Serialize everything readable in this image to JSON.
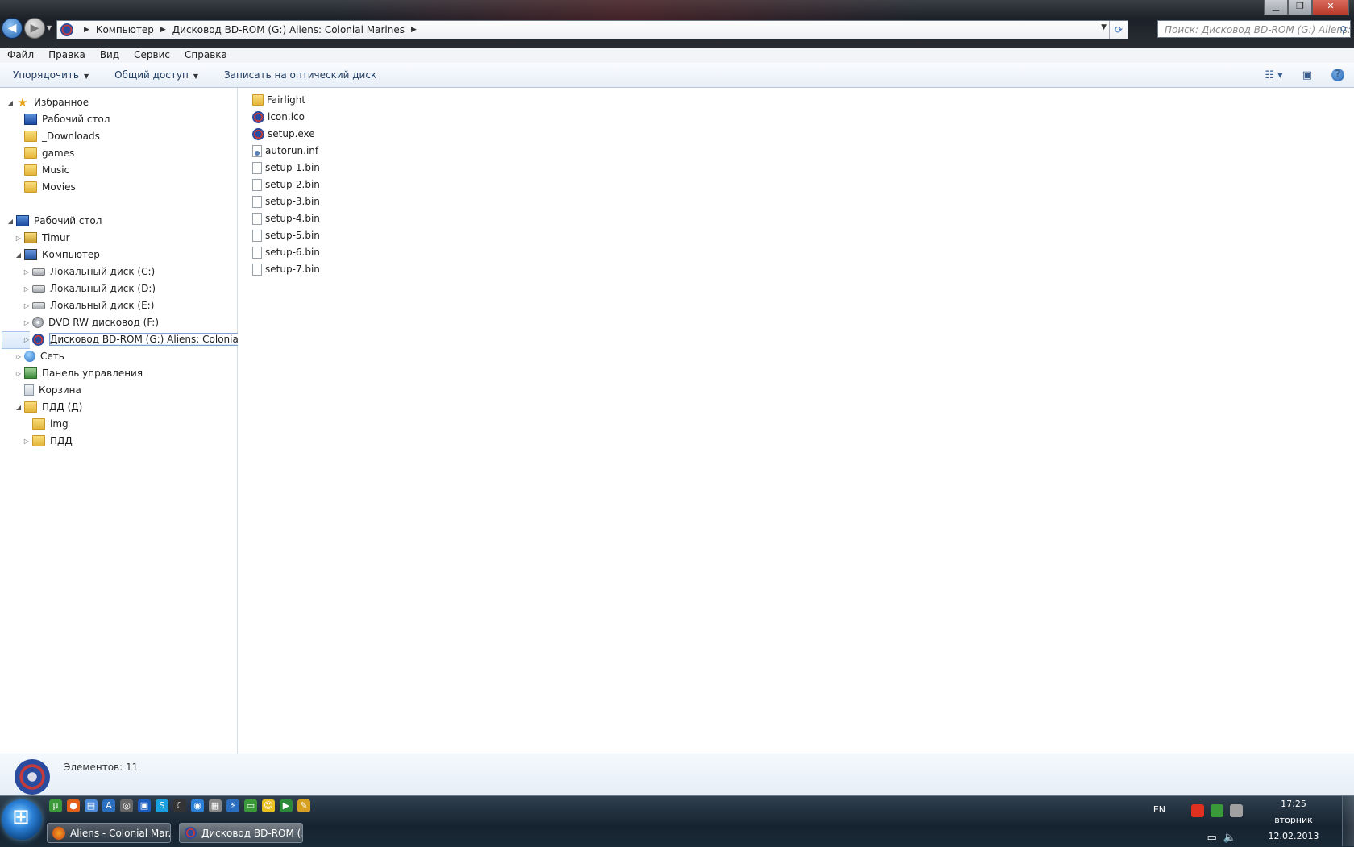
{
  "window": {
    "title_buttons": {
      "minimize": "▁",
      "maximize": "❐",
      "close": "✕"
    }
  },
  "address": {
    "crumbs": [
      "Компьютер",
      "Дисковод BD-ROM (G:) Aliens: Colonial Marines"
    ],
    "search_placeholder": "Поиск: Дисковод BD-ROM (G:) Aliens:...",
    "back_icon": "back-arrow-icon",
    "forward_icon": "forward-arrow-icon"
  },
  "menu": [
    "Файл",
    "Правка",
    "Вид",
    "Сервис",
    "Справка"
  ],
  "toolbar": {
    "organize": "Упорядочить",
    "share": "Общий доступ",
    "burn": "Записать на оптический диск"
  },
  "nav": {
    "favorites": {
      "label": "Избранное",
      "items": [
        "Рабочий стол",
        "_Downloads",
        "games",
        "Music",
        "Movies"
      ]
    },
    "desktop": "Рабочий стол",
    "user": "Timur",
    "computer": "Компьютер",
    "drives": [
      "Локальный диск (C:)",
      "Локальный диск (D:)",
      "Локальный диск (E:)",
      "DVD RW дисковод (F:)",
      "Дисковод BD-ROM (G:) Aliens: Colonial Marines"
    ],
    "network": "Сеть",
    "control_panel": "Панель управления",
    "recycle_bin": "Корзина",
    "pdd_root": "ПДД (Д)",
    "pdd_children": [
      "img",
      "ПДД"
    ]
  },
  "files": [
    {
      "name": "Fairlight",
      "icon": "folder-icon"
    },
    {
      "name": "icon.ico",
      "icon": "aliens-icon"
    },
    {
      "name": "setup.exe",
      "icon": "aliens-icon"
    },
    {
      "name": "autorun.inf",
      "icon": "settings-file-icon"
    },
    {
      "name": "setup-1.bin",
      "icon": "file-icon"
    },
    {
      "name": "setup-2.bin",
      "icon": "file-icon"
    },
    {
      "name": "setup-3.bin",
      "icon": "file-icon"
    },
    {
      "name": "setup-4.bin",
      "icon": "file-icon"
    },
    {
      "name": "setup-5.bin",
      "icon": "file-icon"
    },
    {
      "name": "setup-6.bin",
      "icon": "file-icon"
    },
    {
      "name": "setup-7.bin",
      "icon": "file-icon"
    }
  ],
  "details": {
    "count": "Элементов: 11"
  },
  "taskbar": {
    "tasks": [
      "Aliens - Colonial Mar...",
      "Дисковод BD-ROM (..."
    ],
    "lang": "EN",
    "time": "17:25",
    "day": "вторник",
    "date": "12.02.2013"
  }
}
